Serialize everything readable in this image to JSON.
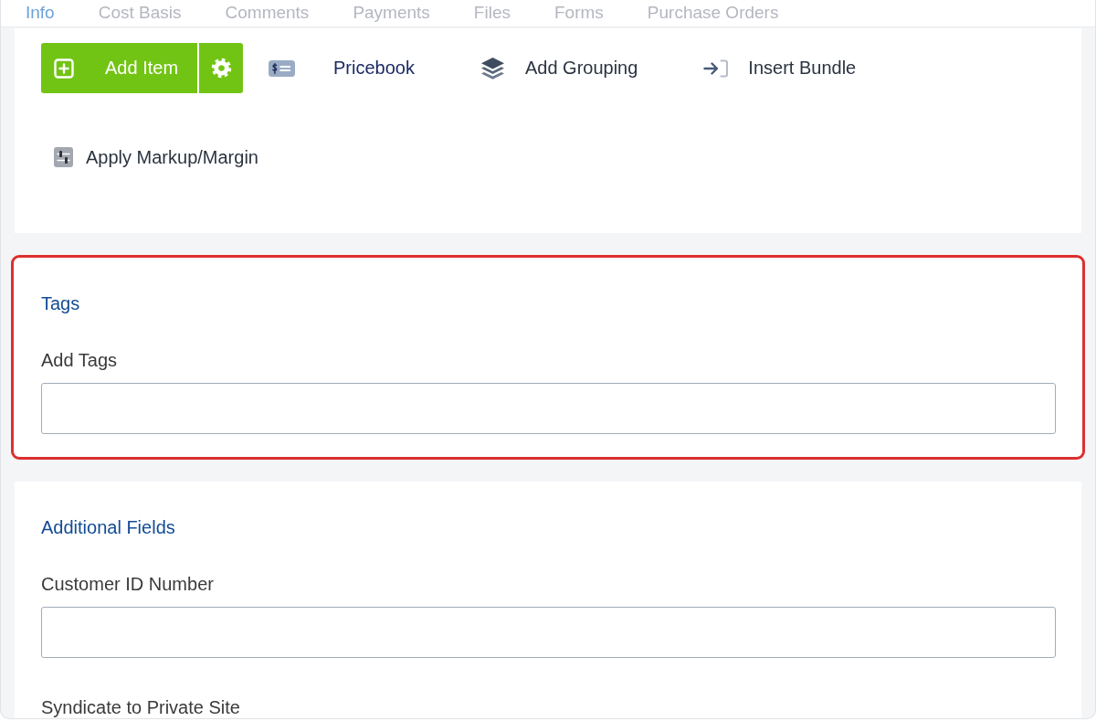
{
  "tabs": [
    {
      "label": "Info",
      "selected": true
    },
    {
      "label": "Cost Basis",
      "selected": false
    },
    {
      "label": "Comments",
      "selected": false
    },
    {
      "label": "Payments",
      "selected": false
    },
    {
      "label": "Files",
      "selected": false
    },
    {
      "label": "Forms",
      "selected": false
    },
    {
      "label": "Purchase Orders",
      "selected": false
    }
  ],
  "toolbar": {
    "add_item": {
      "label": "Add Item"
    },
    "rows": [
      [
        {
          "label": "Pricebook",
          "kind": "link"
        },
        {
          "label": "Add Grouping",
          "kind": "button"
        },
        {
          "label": "Insert Bundle",
          "kind": "button"
        }
      ],
      [
        {
          "label": "Apply Markup/Margin",
          "kind": "button"
        }
      ]
    ]
  },
  "sections": [
    {
      "title": "Tags",
      "highlighted": true,
      "fields": [
        {
          "label": "Add Tags"
        }
      ]
    },
    {
      "title": "Additional Fields",
      "highlighted": false,
      "fields": [
        {
          "label": "Customer ID Number"
        }
      ],
      "next_field_label": "Syndicate to Private Site"
    }
  ]
}
